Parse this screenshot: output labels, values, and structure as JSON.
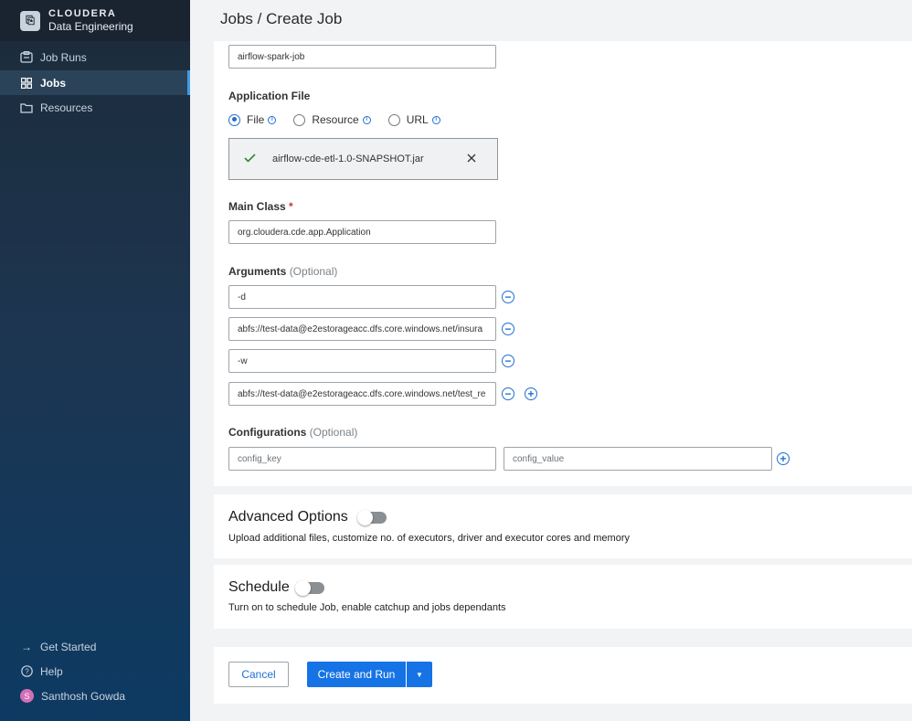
{
  "brand": {
    "line1": "CLOUDERA",
    "line2": "Data Engineering"
  },
  "sidebar": {
    "items": [
      {
        "label": "Job Runs",
        "icon": "job-runs-icon"
      },
      {
        "label": "Jobs",
        "icon": "grid-icon"
      },
      {
        "label": "Resources",
        "icon": "folder-icon"
      }
    ],
    "footer": [
      {
        "label": "Get Started",
        "icon": "arrow-right-icon"
      },
      {
        "label": "Help",
        "icon": "help-icon"
      },
      {
        "label": "Santhosh Gowda",
        "icon": "avatar",
        "initial": "S"
      }
    ]
  },
  "header": {
    "breadcrumb_jobs": "Jobs",
    "separator": "/",
    "breadcrumb_current": "Create Job"
  },
  "form": {
    "job_name_value": "airflow-spark-job",
    "application_file": {
      "label": "Application File",
      "options": [
        "File",
        "Resource",
        "URL"
      ],
      "selected": "File",
      "info_glyph": "i",
      "uploaded_file": "airflow-cde-etl-1.0-SNAPSHOT.jar"
    },
    "main_class": {
      "label": "Main Class",
      "required_mark": "*",
      "value": "org.cloudera.cde.app.Application"
    },
    "arguments": {
      "label": "Arguments",
      "optional": "(Optional)",
      "values": [
        "-d",
        "abfs://test-data@e2estorageacc.dfs.core.windows.net/insura",
        "-w",
        "abfs://test-data@e2estorageacc.dfs.core.windows.net/test_re"
      ]
    },
    "configurations": {
      "label": "Configurations",
      "optional": "(Optional)",
      "key_placeholder": "config_key",
      "value_placeholder": "config_value"
    }
  },
  "advanced": {
    "title": "Advanced Options",
    "description": "Upload additional files, customize no. of executors, driver and executor cores and memory"
  },
  "schedule": {
    "title": "Schedule",
    "description": "Turn on to schedule Job, enable catchup and jobs dependants"
  },
  "actions": {
    "cancel": "Cancel",
    "create_and_run": "Create and Run"
  },
  "colors": {
    "primary": "#1673e6",
    "sidebar_bg": "#1d3550",
    "required": "#d0312d"
  }
}
